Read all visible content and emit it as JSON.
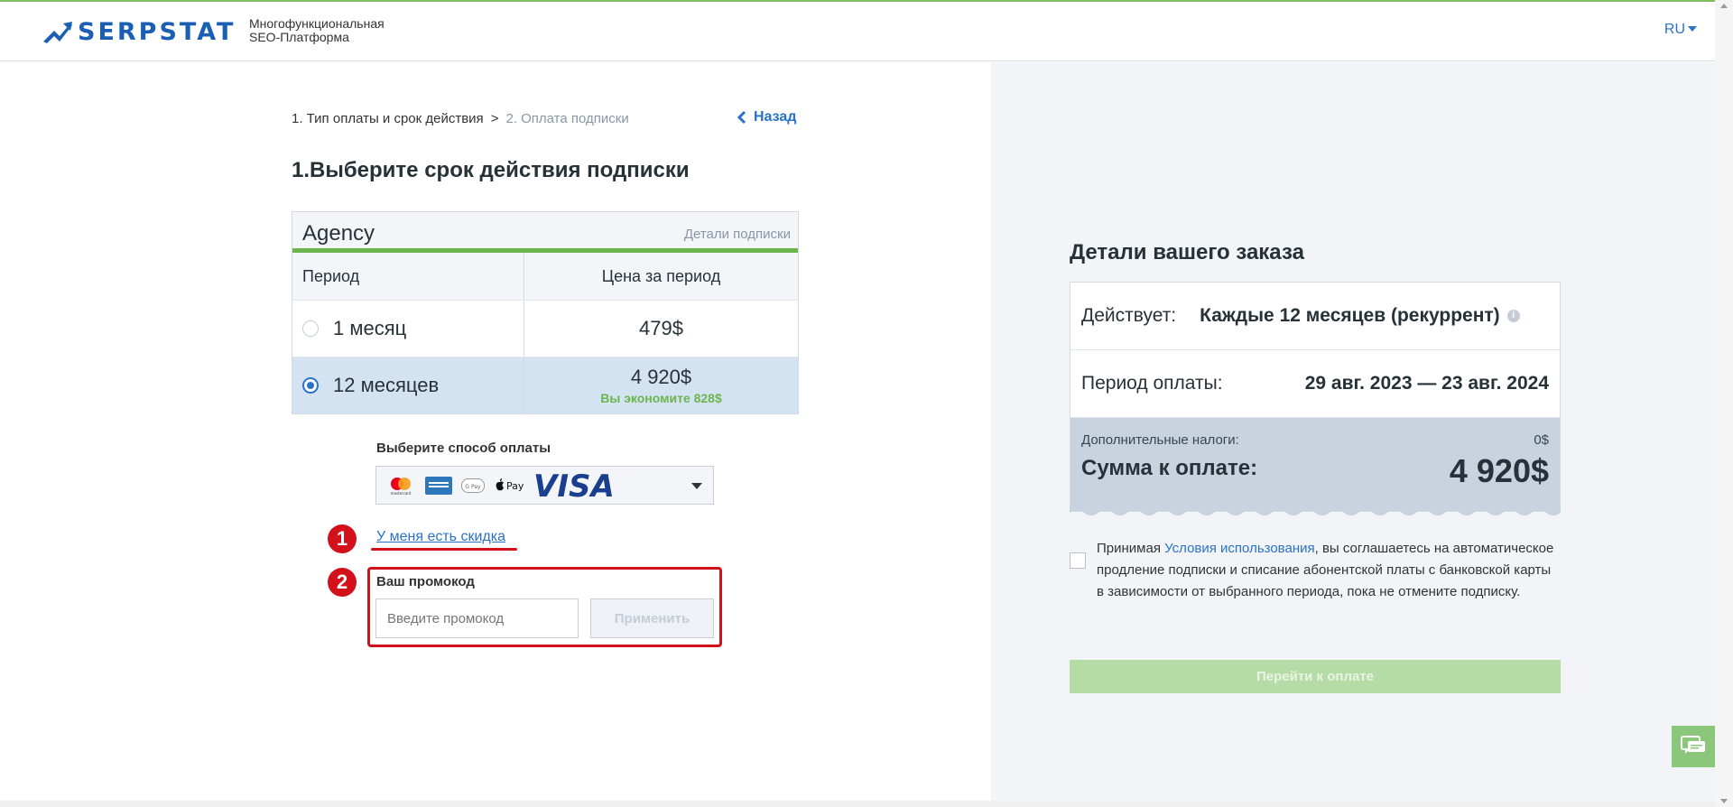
{
  "header": {
    "logo_text": "SERPSTAT",
    "tagline_line1": "Многофункциональная",
    "tagline_line2": "SEO-Платформа",
    "language": "RU"
  },
  "breadcrumb": {
    "step1": "1. Тип оплаты и срок действия",
    "separator": ">",
    "step2": "2. Оплата подписки"
  },
  "back_label": "Назад",
  "page_title": "1.Выберите срок действия подписки",
  "plan": {
    "name": "Agency",
    "details_link": "Детали подписки",
    "col_period": "Период",
    "col_price": "Цена за период",
    "options": [
      {
        "period": "1 месяц",
        "price": "479$",
        "selected": false
      },
      {
        "period": "12 месяцев",
        "price": "4 920$",
        "savings": "Вы экономите 828$",
        "selected": true
      }
    ]
  },
  "payment": {
    "label": "Выберите способ оплаты",
    "icons": [
      "mastercard-icon",
      "amex-icon",
      "gpay-icon",
      "applepay-icon",
      "visa-icon"
    ],
    "applepay_text": "Pay",
    "gpay_text": "G Pay",
    "visa_text": "VISA",
    "mastercard_text": "mastercard"
  },
  "annotations": {
    "marker1": "1",
    "marker2": "2"
  },
  "discount_link": "У меня есть скидка",
  "promo": {
    "label": "Ваш промокод",
    "placeholder": "Введите промокод",
    "apply_label": "Применить"
  },
  "order": {
    "title": "Детали вашего заказа",
    "valid_label": "Действует:",
    "valid_value": "Каждые 12 месяцев (рекуррент)",
    "info_icon": "i",
    "period_label": "Период оплаты:",
    "period_value": "29 авг. 2023 — 23 авг. 2024",
    "tax_label": "Дополнительные налоги:",
    "tax_value": "0$",
    "total_label": "Сумма к оплате:",
    "total_value": "4 920$"
  },
  "agreement": {
    "prefix": "Принимая ",
    "link": "Условия использования",
    "suffix": ", вы соглашаетесь на автоматическое продление подписки и списание абонентской платы с банковской карты в зависимости от выбранного периода, пока не отмените подписку."
  },
  "pay_button": "Перейти к оплате",
  "colors": {
    "accent_blue": "#2a72c6",
    "accent_green": "#6cb54e",
    "annotation_red": "#d3111b",
    "selected_row": "#d3e3f2"
  }
}
